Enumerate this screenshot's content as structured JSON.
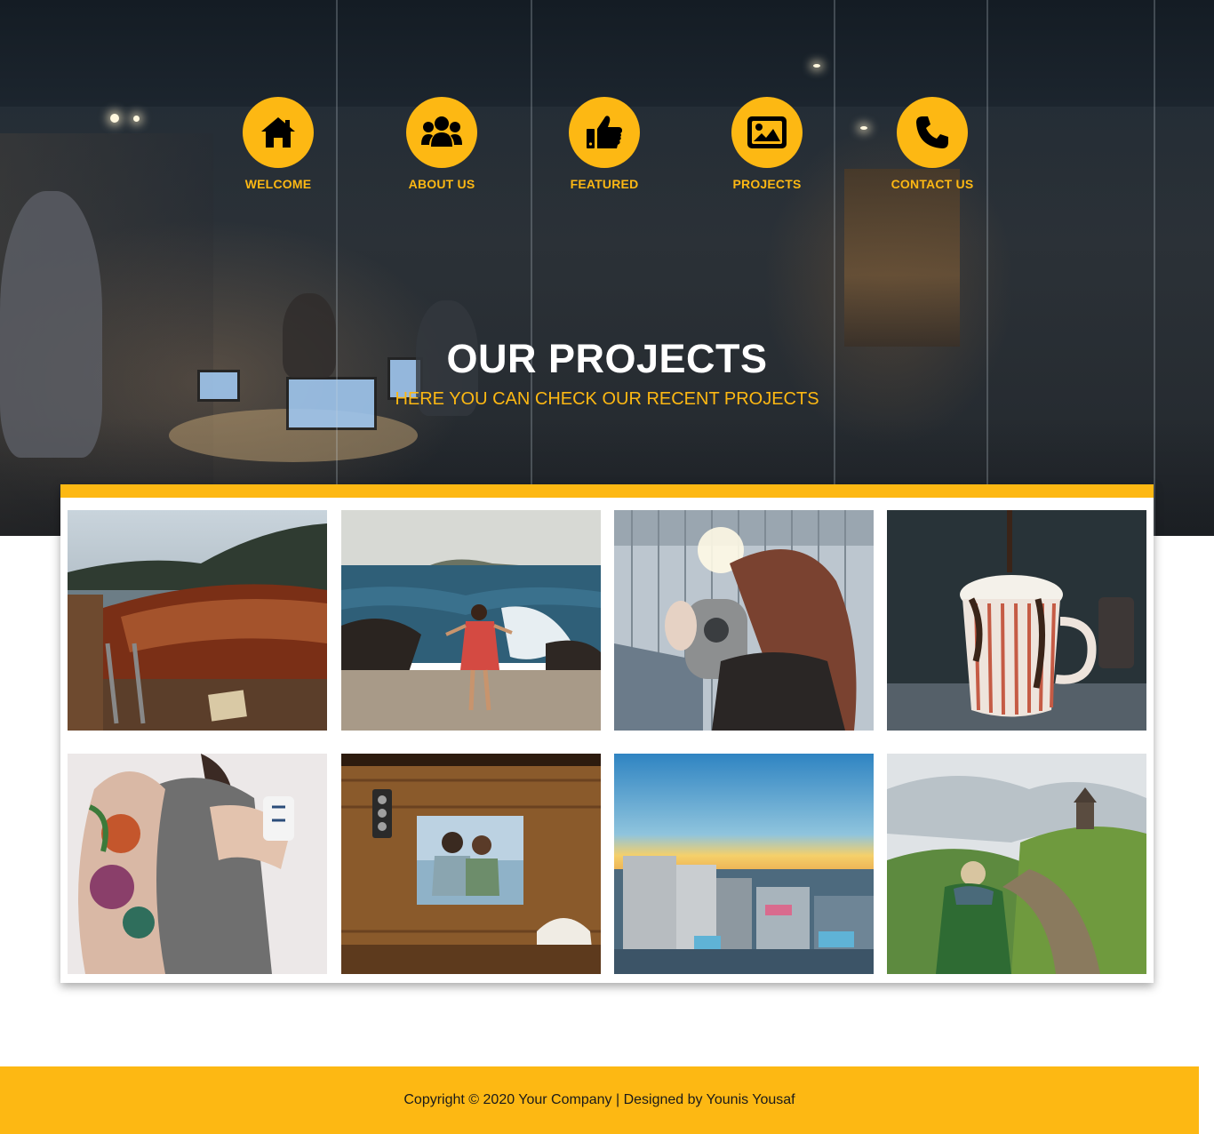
{
  "nav": {
    "items": [
      {
        "label": "WELCOME",
        "icon": "home-icon"
      },
      {
        "label": "ABOUT US",
        "icon": "users-icon"
      },
      {
        "label": "FEATURED",
        "icon": "thumbs-up-icon"
      },
      {
        "label": "PROJECTS",
        "icon": "image-icon"
      },
      {
        "label": "CONTACT US",
        "icon": "phone-icon"
      }
    ]
  },
  "hero": {
    "title": "OUR PROJECTS",
    "subtitle": "HERE YOU CAN CHECK OUR RECENT PROJECTS"
  },
  "gallery": {
    "items": [
      {
        "subject": "wooden boat on a lake"
      },
      {
        "subject": "woman on a rocky beach"
      },
      {
        "subject": "person at a viewing binocular"
      },
      {
        "subject": "hot chocolate mug"
      },
      {
        "subject": "tattooed woman holding a mug"
      },
      {
        "subject": "couple seen through a cabin window"
      },
      {
        "subject": "city skyline at sunset"
      },
      {
        "subject": "hiker on a green hill"
      }
    ]
  },
  "footer": {
    "text": "Copyright © 2020 Your Company | Designed by Younis Yousaf"
  },
  "colors": {
    "accent": "#fdb813",
    "title": "#ffffff",
    "footer_text": "#1a1a1a"
  }
}
